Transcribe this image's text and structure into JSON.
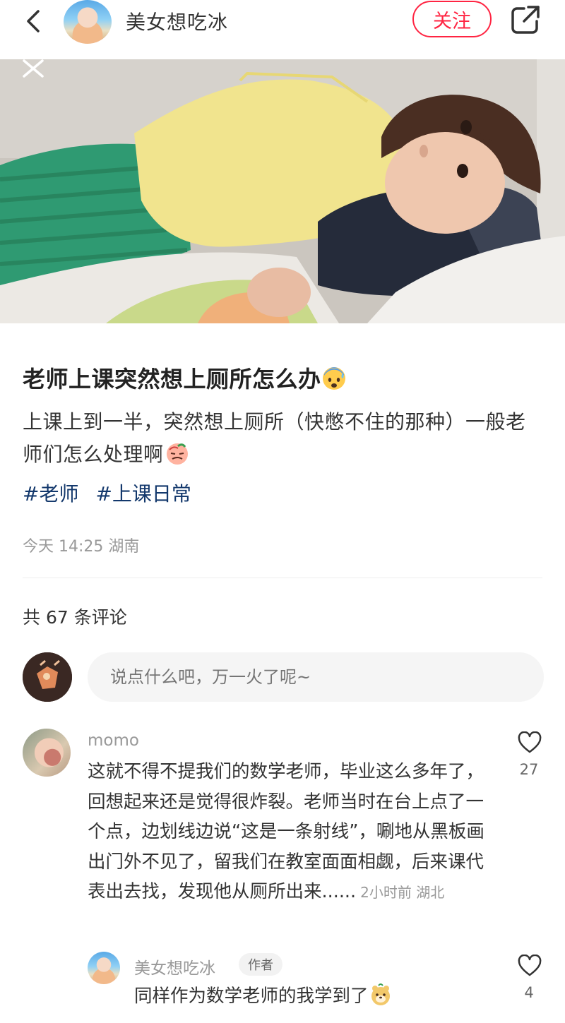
{
  "header": {
    "author_name": "美女想吃冰",
    "follow_label": "关注"
  },
  "post": {
    "title": "老师上课突然想上厕所怎么办",
    "body": "上课上到一半，突然想上厕所（快憋不住的那种）一般老师们怎么处理啊",
    "tags": [
      "#老师",
      "#上课日常"
    ],
    "meta": "今天 14:25 湖南"
  },
  "comments_section": {
    "count_label": "共 67 条评论",
    "input_placeholder": "说点什么吧，万一火了呢~"
  },
  "comments": [
    {
      "user": "momo",
      "text": "这就不得不提我们的数学老师，毕业这么多年了，回想起来还是觉得很炸裂。老师当时在台上点了一个点，边划线边说“这是一条射线”，唰地从黑板画出门外不见了，留我们在教室面面相觑，后来课代表出去找，发现他从厕所出来......",
      "time_location": "2小时前 湖北",
      "likes": "27"
    }
  ],
  "reply": {
    "user": "美女想吃冰",
    "badge": "作者",
    "text": "同样作为数学老师的我学到了",
    "likes": "4"
  },
  "colors": {
    "accent": "#ff2442",
    "tag": "#13386c",
    "muted": "#999999"
  },
  "icons": [
    "back-arrow-icon",
    "share-icon",
    "close-icon",
    "heart-outline-icon",
    "anxious-sweat-emoji",
    "sad-face-emoji",
    "bear-emoji"
  ]
}
